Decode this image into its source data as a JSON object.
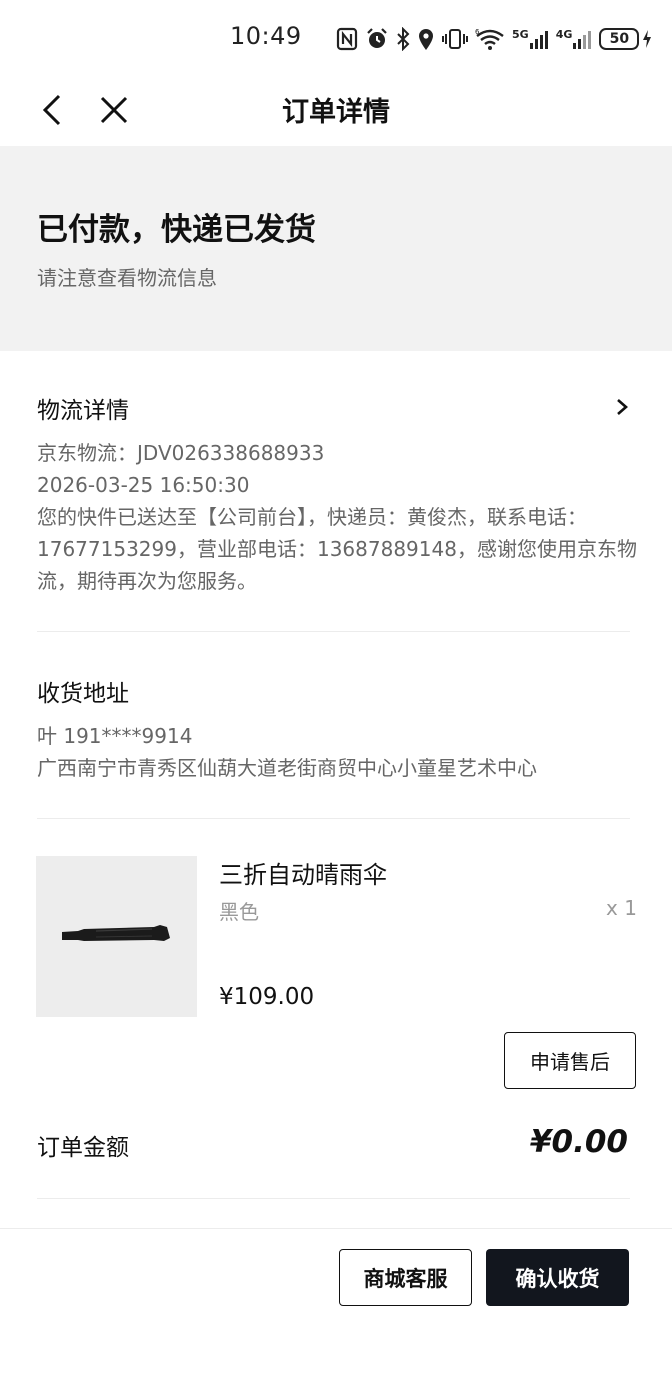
{
  "status_bar": {
    "time": "10:49",
    "network_5g": "5G",
    "network_4g": "4G",
    "battery": "50",
    "icons": [
      "nfc-icon",
      "alarm-icon",
      "bluetooth-icon",
      "location-icon",
      "vibrate-icon",
      "wifi-icon",
      "signal-5g-icon",
      "signal-4g-icon",
      "battery-icon",
      "charging-icon"
    ]
  },
  "nav": {
    "title": "订单详情",
    "back_icon": "chevron-left-icon",
    "close_icon": "close-icon"
  },
  "order_status": {
    "title": "已付款，快递已发货",
    "subtitle": "请注意查看物流信息"
  },
  "logistics": {
    "title": "物流详情",
    "carrier_line": "京东物流：JDV026338688933",
    "time": "2026-03-25 16:50:30",
    "message": "您的快件已送达至【公司前台】，快递员：黄俊杰，联系电话：17677153299，营业部电话：13687889148，感谢您使用京东物流，期待再次为您服务。"
  },
  "address": {
    "title": "收货地址",
    "contact": "叶  191****9914",
    "detail": "广西南宁市青秀区仙葫大道老街商贸中心小童星艺术中心"
  },
  "product": {
    "name": "三折自动晴雨伞",
    "spec": "黑色",
    "qty": "x 1",
    "price": "¥109.00"
  },
  "after_sale_label": "申请售后",
  "order_amount": {
    "label": "订单金额",
    "value": "¥0.00"
  },
  "actions": {
    "service_label": "商城客服",
    "confirm_label": "确认收货",
    "confirm_bg": "#12161e"
  }
}
